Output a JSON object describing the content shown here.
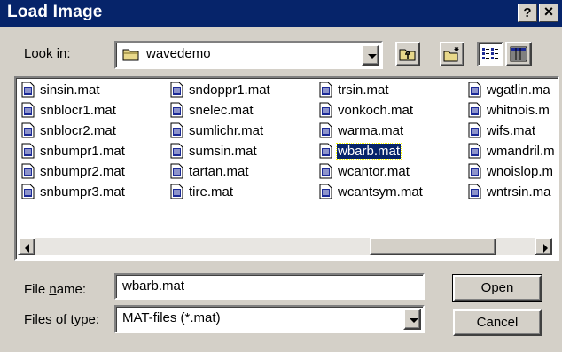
{
  "window": {
    "title": "Load Image",
    "help_label": "?",
    "close_label": "×"
  },
  "look_in": {
    "label_before": "Look ",
    "label_hot": "i",
    "label_after": "n:",
    "value": "wavedemo"
  },
  "toolbar": {
    "up_icon": "up-one-level-icon",
    "new_folder_icon": "new-folder-icon",
    "list_view_icon": "list-view-icon",
    "details_view_icon": "details-view-icon"
  },
  "files": [
    [
      "sinsin.mat",
      "sndoppr1.mat",
      "trsin.mat",
      "wgatlin.ma"
    ],
    [
      "snblocr1.mat",
      "snelec.mat",
      "vonkoch.mat",
      "whitnois.m"
    ],
    [
      "snblocr2.mat",
      "sumlichr.mat",
      "warma.mat",
      "wifs.mat"
    ],
    [
      "snbumpr1.mat",
      "sumsin.mat",
      "wbarb.mat",
      "wmandril.m"
    ],
    [
      "snbumpr2.mat",
      "tartan.mat",
      "wcantor.mat",
      "wnoislop.m"
    ],
    [
      "snbumpr3.mat",
      "tire.mat",
      "wcantsym.mat",
      "wntrsin.ma"
    ]
  ],
  "selected_file": "wbarb.mat",
  "file_name": {
    "label_before": "File ",
    "label_hot": "n",
    "label_after": "ame:",
    "value": "wbarb.mat"
  },
  "file_type": {
    "label_before": "Files of ",
    "label_hot": "t",
    "label_after": "ype:",
    "value": "MAT-files (*.mat)"
  },
  "buttons": {
    "open_hot": "O",
    "open_rest": "pen",
    "cancel": "Cancel"
  },
  "colors": {
    "titlebar": "#06246a",
    "face": "#d4d0c8",
    "selection": "#06246a",
    "file_icon": "#1c2a96"
  }
}
